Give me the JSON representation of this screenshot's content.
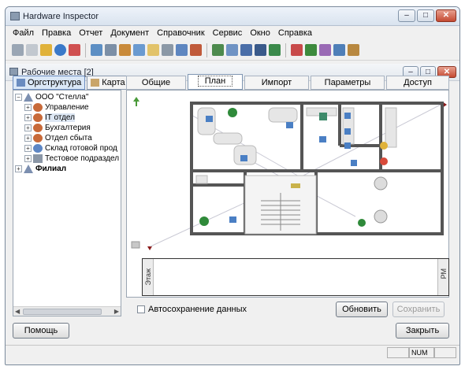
{
  "window": {
    "title": "Hardware Inspector",
    "buttons": {
      "minimize": "–",
      "maximize": "□",
      "close": "✕"
    }
  },
  "menu": [
    "Файл",
    "Правка",
    "Отчет",
    "Документ",
    "Справочник",
    "Сервис",
    "Окно",
    "Справка"
  ],
  "child_window": {
    "title": "Рабочие места [2]"
  },
  "left_tabs": {
    "org": "Оргструктура",
    "map": "Карта"
  },
  "tree": [
    {
      "label": "ООО \"Стелла\"",
      "level": 0,
      "expander": "−"
    },
    {
      "label": "Управление",
      "level": 1,
      "expander": "+"
    },
    {
      "label": "IT отдел",
      "level": 1,
      "expander": "+",
      "selected": true
    },
    {
      "label": "Бухгалтерия",
      "level": 1,
      "expander": "+"
    },
    {
      "label": "Отдел сбыта",
      "level": 1,
      "expander": "+"
    },
    {
      "label": "Склад готовой прод",
      "level": 1,
      "expander": "+"
    },
    {
      "label": "Тестовое подраздел",
      "level": 1,
      "expander": "+"
    },
    {
      "label": "Филиал",
      "level": 0,
      "expander": "+"
    }
  ],
  "right_tabs": [
    "Общие",
    "План",
    "Импорт",
    "Параметры",
    "Доступ"
  ],
  "active_right_tab": "План",
  "floor": {
    "left_label": "Этаж",
    "right_label": "РМ"
  },
  "autosave_label": "Автосохранение данных",
  "buttons": {
    "refresh": "Обновить",
    "save": "Сохранить",
    "help": "Помощь",
    "close": "Закрыть"
  },
  "status": {
    "num": "NUM"
  },
  "colors": {
    "accent": "#6a8cc0",
    "wall": "#555555",
    "plant": "#2f8a3a",
    "desk": "#e6e6e6",
    "arrow": "#8a1a1a"
  }
}
